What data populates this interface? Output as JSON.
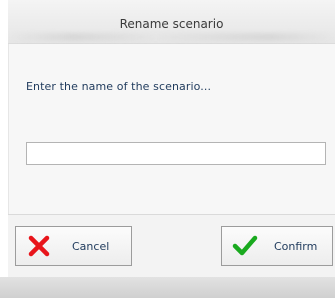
{
  "dialog": {
    "title": "Rename scenario",
    "prompt": "Enter the name of the scenario...",
    "input": {
      "value": "",
      "placeholder": ""
    }
  },
  "buttons": {
    "cancel": {
      "label": "Cancel",
      "icon": "close-icon",
      "color": "#e8151b"
    },
    "confirm": {
      "label": "Confirm",
      "icon": "checkmark-icon",
      "color": "#1aaa1f"
    }
  }
}
